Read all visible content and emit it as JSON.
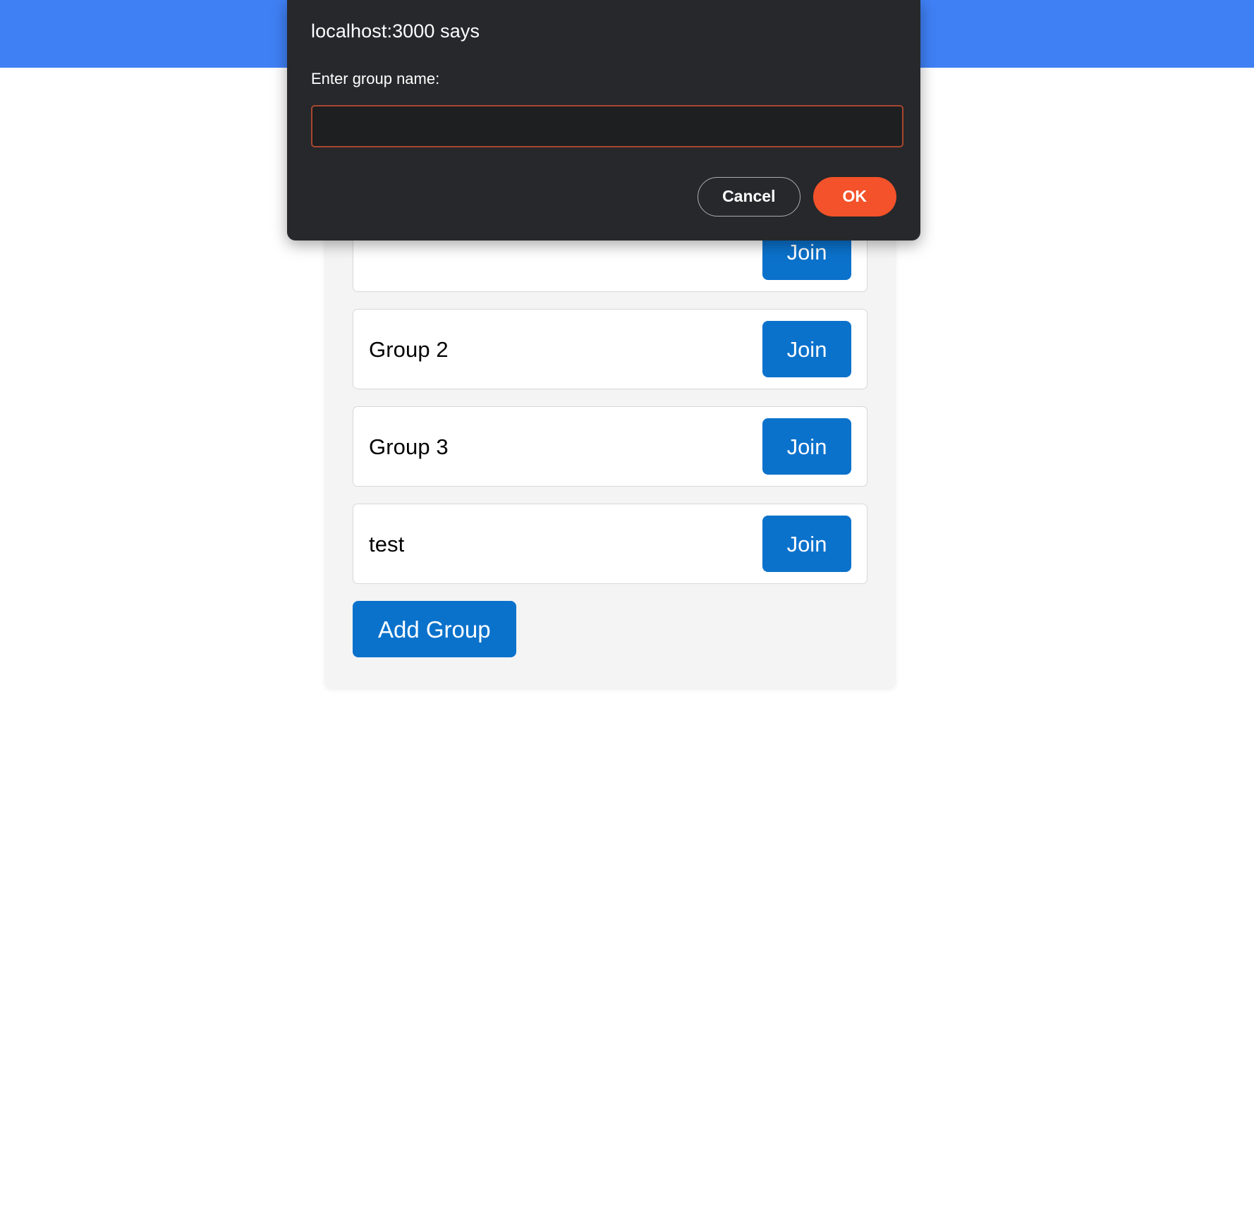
{
  "header": {
    "color": "#3f80f5"
  },
  "main": {
    "groups": [
      {
        "name": "",
        "join_label": "Join"
      },
      {
        "name": "Group 2",
        "join_label": "Join"
      },
      {
        "name": "Group 3",
        "join_label": "Join"
      },
      {
        "name": "test",
        "join_label": "Join"
      }
    ],
    "add_group_label": "Add Group",
    "accent_color": "#0b72cc"
  },
  "dialog": {
    "title": "localhost:3000 says",
    "message": "Enter group name:",
    "input_value": "",
    "input_placeholder": "",
    "cancel_label": "Cancel",
    "ok_label": "OK",
    "ok_color": "#f4522a",
    "background_color": "#26282b"
  }
}
